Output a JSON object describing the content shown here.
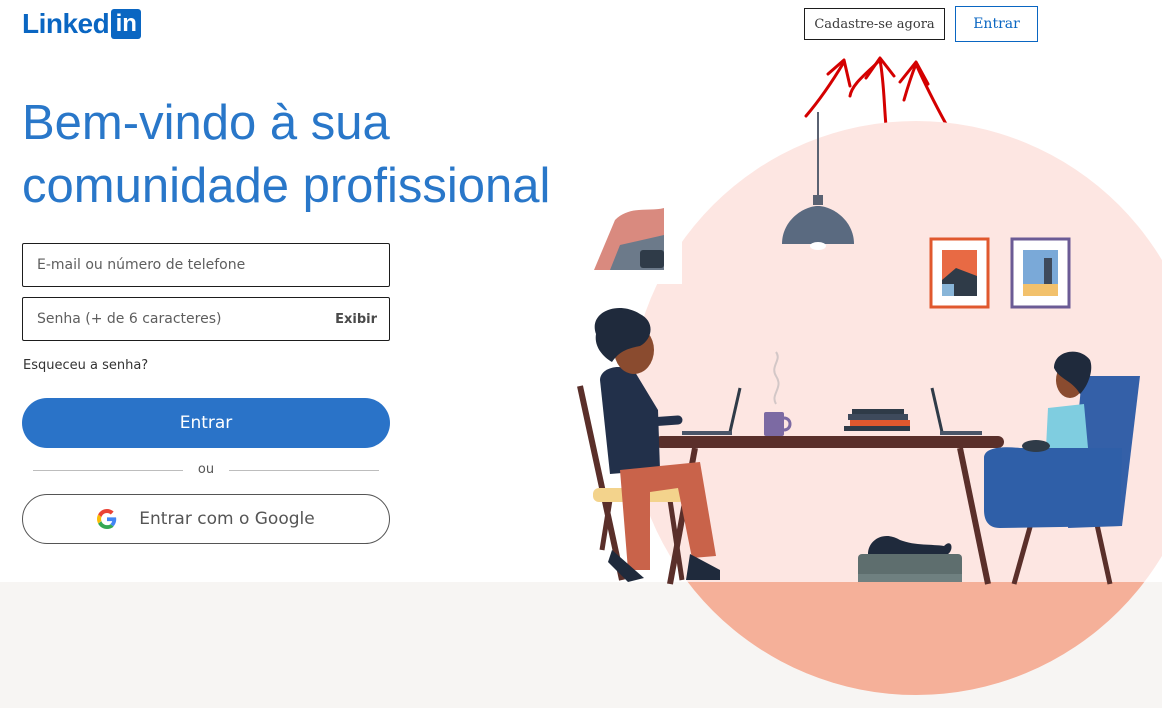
{
  "header": {
    "logo_text": "Linked",
    "logo_box": "in",
    "signup_label": "Cadastre-se agora",
    "signin_label": "Entrar"
  },
  "main": {
    "headline_line1": "Bem-vindo à sua",
    "headline_line2": "comunidade profissional",
    "email_placeholder": "E-mail ou número de telefone",
    "email_value": "",
    "password_placeholder": "Senha (+ de 6 caracteres)",
    "password_value": "",
    "show_password_label": "Exibir",
    "forgot_label": "Esqueceu a senha?",
    "signin_button_label": "Entrar",
    "divider_text": "ou",
    "google_button_label": "Entrar com o Google"
  },
  "colors": {
    "brand": "#0a66c2",
    "headline": "#2977c9",
    "primary_button": "#2a73c8",
    "illustration_circle": "#fde6e2",
    "annotation_arrows": "#d40000"
  },
  "icons": {
    "google": "google-g-icon",
    "annotation": "red-arrow-annotation-icon"
  }
}
